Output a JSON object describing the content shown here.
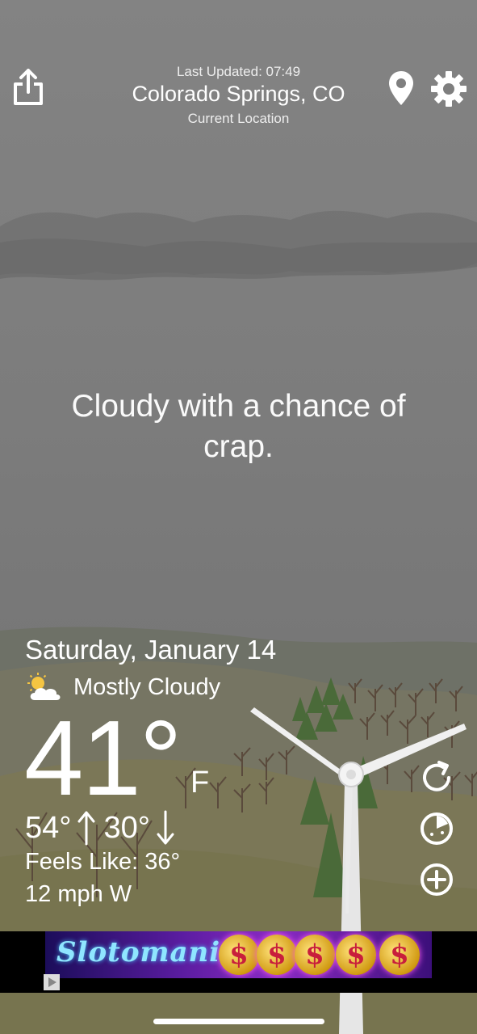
{
  "header": {
    "last_updated": "Last Updated: 07:49",
    "city": "Colorado Springs, CO",
    "location_label": "Current Location",
    "share_icon": "share-icon",
    "location_icon": "location-pin-icon",
    "settings_icon": "gear-icon"
  },
  "tagline": "Cloudy with a chance of crap.",
  "current": {
    "date": "Saturday, January 14",
    "condition": "Mostly Cloudy",
    "condition_icon": "partly-cloudy-icon",
    "temperature": "41°",
    "unit": "F",
    "high": "54°",
    "low": "30°",
    "feels_like": "Feels Like: 36°",
    "wind": "12 mph W"
  },
  "side_actions": {
    "refresh_icon": "refresh-icon",
    "radar_icon": "radar-icon",
    "add_icon": "add-circle-icon"
  },
  "ad": {
    "brand": "Slotomania",
    "coin_symbol": "$"
  },
  "colors": {
    "sky": "#7d7d7d",
    "hills_far": "#6f7268",
    "hills_near": "#7a7653",
    "tree_green": "#4f6b3a",
    "text": "#ffffff"
  }
}
